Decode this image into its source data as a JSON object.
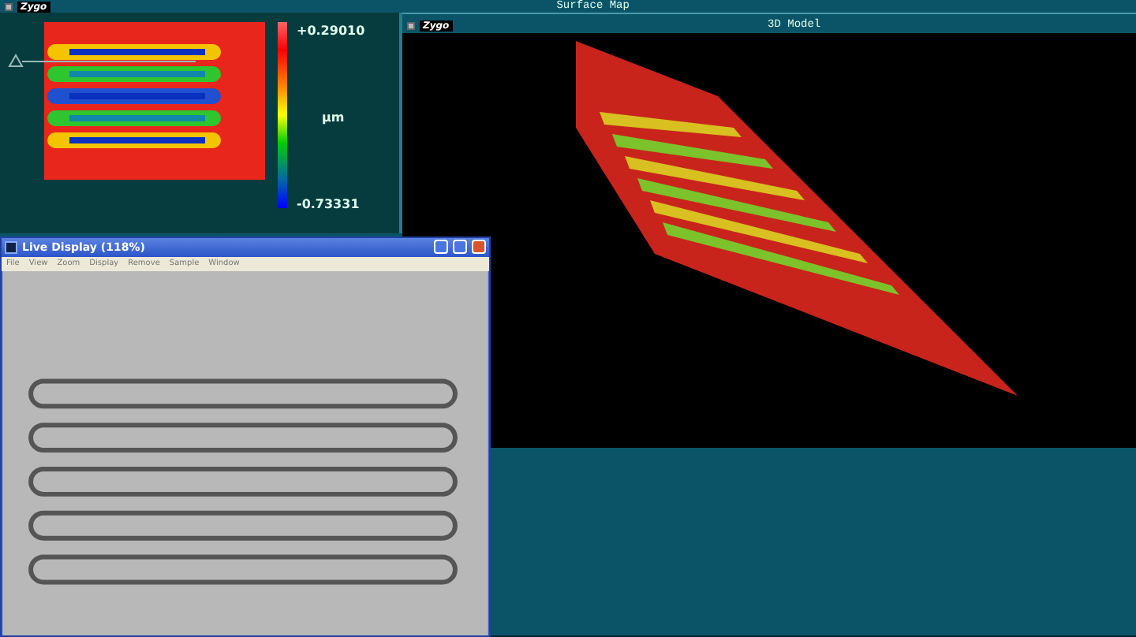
{
  "window": {
    "logo": "Zygo",
    "title": "Surface Map"
  },
  "surface_map": {
    "scale_max": "+0.29010",
    "unit": "µm",
    "scale_min": "-0.73331"
  },
  "model_3d": {
    "logo": "Zygo",
    "title": "3D Model"
  },
  "live_display": {
    "title": "Live Display (118%)",
    "menu": [
      "File",
      "View",
      "Zoom",
      "Display",
      "Remove",
      "Sample",
      "Window"
    ]
  }
}
